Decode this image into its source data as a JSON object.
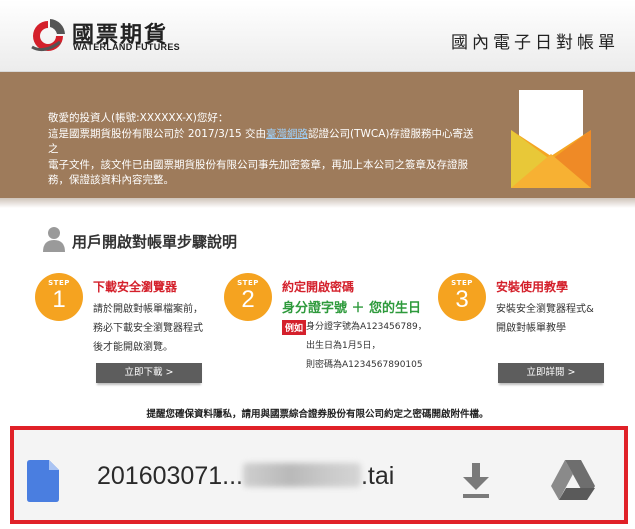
{
  "header": {
    "brand_cn": "國票期貨",
    "brand_en": "WATERLAND FUTURES",
    "title": "國內電子日對帳單"
  },
  "banner": {
    "greeting": "敬愛的投資人(帳號:XXXXXX-X)您好：",
    "line1_pre": "這是國票期貨股份有限公司於 2017/3/15 交由",
    "line1_link": "臺灣網路",
    "line1_post": "認證公司(TWCA)存證服務中心寄送之",
    "line2": "電子文件，該文件已由國票期貨股份有限公司事先加密簽章，再加上本公司之簽章及存證服",
    "line3": "務，保證該資料內容完整。"
  },
  "steps_section": {
    "title": "用戶開啟對帳單步驟說明",
    "step_word": "STEP",
    "steps": [
      {
        "number": "1",
        "title": "下載安全瀏覽器",
        "desc": [
          "請於開啟對帳單檔案前，",
          "務必下載安全瀏覽器程式",
          "後才能開啟瀏覽。"
        ],
        "button": "立即下載 >"
      },
      {
        "number": "2",
        "title": "約定開啟密碼",
        "highlight": "身分證字號 ＋ 您的生日",
        "example_tag": "例如",
        "desc": [
          "身分證字號為A123456789，",
          "出生日為1月5日，",
          "則密碼為A1234567890105"
        ]
      },
      {
        "number": "3",
        "title": "安裝使用教學",
        "desc": [
          "安裝安全瀏覽器程式&",
          "開啟對帳單教學"
        ],
        "button": "立即詳閱 >"
      }
    ],
    "notice": "提醒您確保資料隱私，請用與國票綜合證券股份有限公司約定之密碼開啟附件檔。"
  },
  "download_bar": {
    "file_prefix": "201603071...",
    "file_suffix": ".tai",
    "file_icon": "document-icon",
    "download_icon": "download-icon",
    "drive_icon": "google-drive-icon"
  },
  "colors": {
    "banner": "#9e7b5b",
    "step_orange": "#f5a320",
    "step_title_red": "#d4202b",
    "highlight_green": "#2e9a3c",
    "frame_red": "#e02128"
  }
}
